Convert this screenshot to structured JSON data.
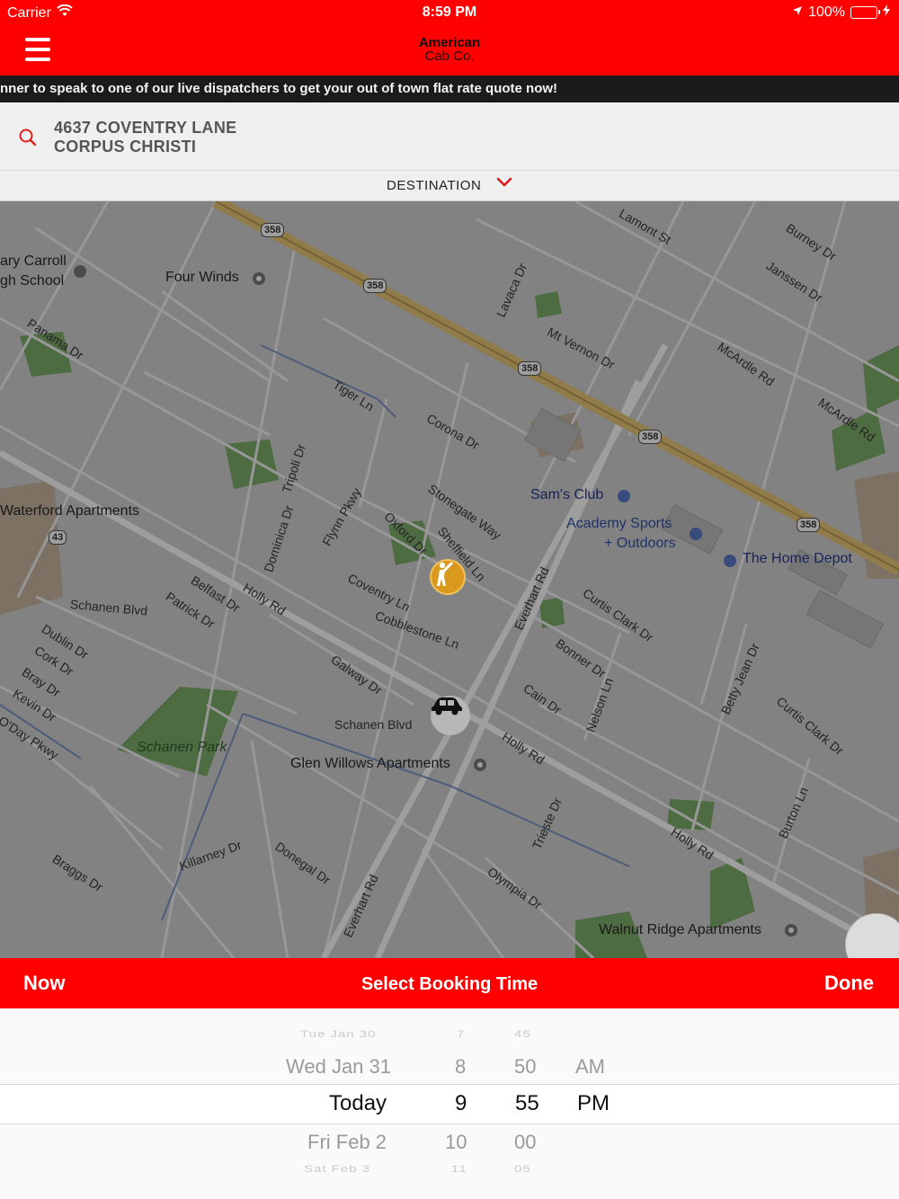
{
  "status_bar": {
    "carrier": "Carrier",
    "time": "8:59 PM",
    "battery": "100%"
  },
  "header": {
    "brand_line1": "American",
    "brand_line2": "Cab Co.",
    "menu_icon": "hamburger-icon"
  },
  "ticker": {
    "text": "nner to speak to one of our live dispatchers to get your out of town flat rate quote now!"
  },
  "pickup": {
    "line1": "4637 COVENTRY LANE",
    "line2": "CORPUS CHRISTI",
    "icon": "search-icon"
  },
  "destination": {
    "label": "DESTINATION",
    "icon": "chevron-down-icon"
  },
  "map": {
    "labels": {
      "four_winds": "Four Winds",
      "carroll1": "ary Carroll",
      "carroll2": "gh School",
      "waterford": "Waterford Apartments",
      "sams_club": "Sam's Club",
      "academy1": "Academy Sports",
      "academy2": "+ Outdoors",
      "home_depot": "The Home Depot",
      "schanen_park": "Schanen Park",
      "glen_willows": "Glen Willows Apartments",
      "walnut_ridge": "Walnut Ridge Apartments",
      "schanen_blvd_1": "Schanen Blvd",
      "schanen_blvd_2": "Schanen Blvd",
      "coventry_ln": "Coventry Ln",
      "cobblestone_ln": "Cobblestone Ln",
      "holly_rd_1": "Holly Rd",
      "holly_rd_2": "Holly Rd",
      "holly_rd_3": "Holly Rd",
      "everhart_rd_1": "Everhart Rd",
      "everhart_rd_2": "Everhart Rd",
      "mt_vernon_dr": "Mt Vernon Dr",
      "corona_dr": "Corona Dr",
      "stonegate_way": "Stonegate Way",
      "curtis_clark_dr_1": "Curtis Clark Dr",
      "curtis_clark_dr_2": "Curtis Clark Dr",
      "bonner_dr": "Bonner Dr",
      "cain_dr": "Cain Dr",
      "galway_dr": "Galway Dr",
      "mcardle_rd_1": "McArdle Rd",
      "mcardle_rd_2": "McArdle Rd",
      "tiger_ln": "Tiger Ln",
      "panama_dr": "Panama Dr",
      "belfast_dr": "Belfast Dr",
      "patrick_dr": "Patrick Dr",
      "dublin_dr": "Dublin Dr",
      "cork_dr": "Cork Dr",
      "bray_dr": "Bray Dr",
      "kevin_dr": "Kevin Dr",
      "oday_pkwy": "O'Day Pkwy",
      "braggs_dr": "Braggs Dr",
      "killarney_dr": "Killarney Dr",
      "donegal_dr": "Donegal Dr",
      "olympia_dr": "Olympia Dr",
      "trieste_dr": "Trieste Dr",
      "nelson_ln": "Nelson Ln",
      "betty_jean_dr": "Betty Jean Dr",
      "burton_ln": "Burton Ln",
      "lavaca_dr": "Lavaca Dr",
      "burney_dr": "Burney Dr",
      "janssen_dr": "Janssen Dr",
      "lamont_st": "Lamont St",
      "oxford_dr": "Oxford Dr",
      "sheffield_ln": "Sheffield Ln",
      "flynn_pkwy": "Flynn Pkwy",
      "dominica_dr": "Dominica Dr",
      "tripoli_dr": "Tripoli Dr"
    },
    "shields": [
      "358",
      "358",
      "358",
      "358",
      "358",
      "43"
    ],
    "pickup_icon": "person-hail-icon",
    "car_icon": "car-icon"
  },
  "booking": {
    "now_label": "Now",
    "title": "Select Booking Time",
    "done_label": "Done"
  },
  "picker": {
    "days": [
      "Tue Jan 30",
      "Wed Jan 31",
      "Today",
      "Fri Feb 2",
      "Sat Feb 3"
    ],
    "hours": [
      "7",
      "8",
      "9",
      "10",
      "11"
    ],
    "minutes": [
      "45",
      "50",
      "55",
      "00",
      "05"
    ],
    "ampm": [
      "",
      "AM",
      "PM",
      "",
      ""
    ]
  },
  "colors": {
    "brand_red": "#fe0000",
    "ticker_bg": "#1b1b1b",
    "pin_gold": "#d8991d",
    "battery_green": "#4cd964"
  }
}
